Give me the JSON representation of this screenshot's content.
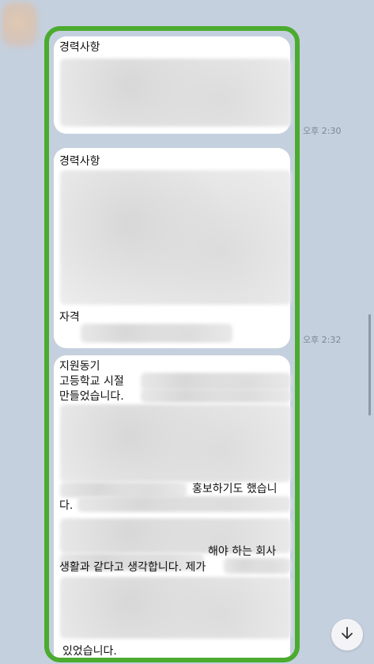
{
  "chat": {
    "messages": [
      {
        "heading": "경력사항"
      },
      {
        "heading": "경력사항",
        "subheading": "자격"
      },
      {
        "heading": "지원동기",
        "lines": [
          "고등학교 시절",
          "만들었습니다.",
          "홍보하기도 했습니",
          "다.",
          "해야 하는 회사",
          "생활과 같다고 생각합니다. 제가",
          "있었습니다."
        ]
      }
    ],
    "timestamps": [
      "오후 2:30",
      "오후 2:32"
    ]
  },
  "icons": {
    "scroll_down": "arrow-down-icon"
  },
  "colors": {
    "highlight_border": "#4bab2f",
    "background": "#c5d0de"
  }
}
